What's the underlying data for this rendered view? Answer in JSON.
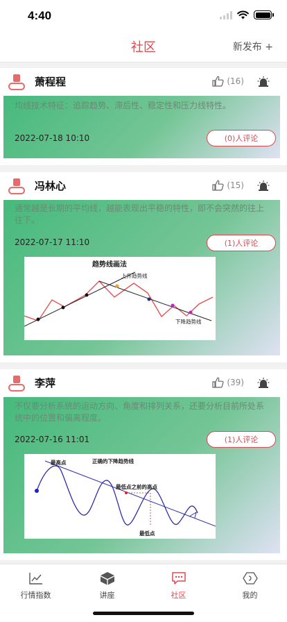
{
  "status_bar": {
    "time": "4:40"
  },
  "nav": {
    "title": "社区",
    "publish_label": "新发布 +"
  },
  "posts": [
    {
      "author": "萧程程",
      "likes": "(16)",
      "text": "均线技术特征：追踪趋势、滞后性、稳定性和压力线特性。",
      "date": "2022-07-18 10:10",
      "comment_label": "(0)人评论"
    },
    {
      "author": "冯林心",
      "likes": "(15)",
      "text": "通常越是长期的平均线，越能表现出平稳的特性，即不会突然的往上往下。",
      "date": "2022-07-17 11:10",
      "comment_label": "(1)人评论",
      "image": {
        "title": "趋势线画法",
        "upper_label": "上升趋势线",
        "lower_label": "下降趋势线"
      }
    },
    {
      "author": "李萍",
      "likes": "(39)",
      "text": "不仅要分析系统的运动方向、角度和排列关系，还要分析目前所处系统中的位置和偏离程度。",
      "date": "2022-07-16 11:01",
      "comment_label": "(1)人评论",
      "image": {
        "title": "正确的下降趋势线",
        "peak_label": "最高点",
        "prev_peak_label": "最低点之前的高点",
        "low_label": "最低点"
      }
    }
  ],
  "tabs": [
    {
      "label": "行情指数",
      "icon": "chart-line-icon"
    },
    {
      "label": "讲座",
      "icon": "cube-icon"
    },
    {
      "label": "社区",
      "icon": "chat-bubble-icon",
      "active": true
    },
    {
      "label": "我的",
      "icon": "hexagon-icon"
    }
  ],
  "colors": {
    "accent": "#e0464e",
    "green_start": "#46ba7c",
    "lavender_end": "#dfe1f3"
  }
}
